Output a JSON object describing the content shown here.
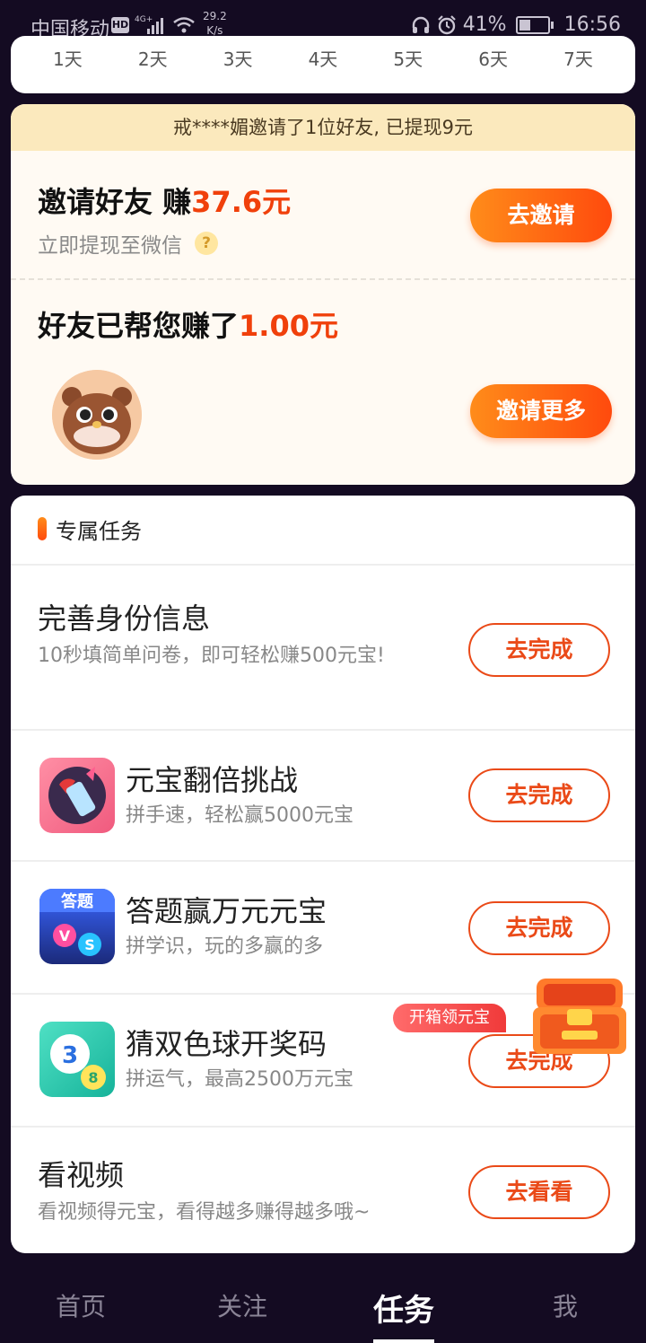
{
  "status_bar": {
    "carrier": "中国移动",
    "hd": "HD",
    "network": "4G+",
    "speed_value": "29.2",
    "speed_unit": "K/s",
    "battery": "41%",
    "time": "16:56"
  },
  "days": [
    "1天",
    "2天",
    "3天",
    "4天",
    "5天",
    "6天",
    "7天"
  ],
  "invite": {
    "banner": "戒****媚邀请了1位好友, 已提现9元",
    "title_prefix": "邀请好友 赚",
    "title_amount": "37.6元",
    "subtitle": "立即提现至微信",
    "help_icon": "?",
    "invite_button": "去邀请",
    "earned_prefix": "好友已帮您赚了",
    "earned_amount": "1.00元",
    "invite_more_button": "邀请更多"
  },
  "tasks": {
    "header": "专属任务",
    "items": [
      {
        "title": "完善身份信息",
        "subtitle": "10秒填简单问卷，即可轻松赚500元宝!",
        "button": "去完成"
      },
      {
        "title": "元宝翻倍挑战",
        "subtitle": "拼手速，轻松赢5000元宝",
        "button": "去完成",
        "icon": "lipstick-game-icon"
      },
      {
        "title": "答题赢万元元宝",
        "subtitle": "拼学识，玩的多赢的多",
        "button": "去完成",
        "icon": "quiz-vs-icon",
        "icon_text": "答题"
      },
      {
        "title": "猜双色球开奖码",
        "subtitle": "拼运气，最高2500万元宝",
        "button": "去完成",
        "icon": "lottery-ball-icon"
      },
      {
        "title": "看视频",
        "subtitle": "看视频得元宝，看得越多赚得越多哦~",
        "button": "去看看"
      }
    ],
    "chest_tag": "开箱领元宝"
  },
  "bottom_nav": {
    "items": [
      "首页",
      "关注",
      "任务",
      "我"
    ],
    "active": "任务"
  },
  "colors": {
    "accent": "#f0400b",
    "banner_bg": "#fbe9bd",
    "background": "#140b22"
  }
}
